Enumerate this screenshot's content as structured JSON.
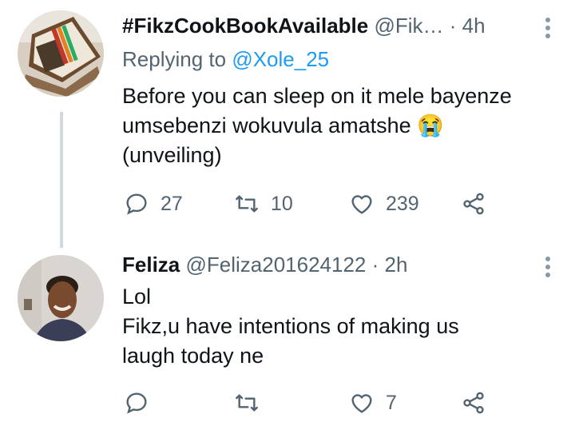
{
  "tweets": [
    {
      "display_name": "#FikzCookBookAvailable",
      "handle": "@Fik…",
      "time": "· 4h",
      "reply_prefix": "Replying to ",
      "reply_to": "@Xole_25",
      "text_lines": [
        "Before you can sleep on it mele bayenze",
        "umsebenzi wokuvula amatshe 😭",
        "(unveiling)"
      ],
      "replies": "27",
      "retweets": "10",
      "likes": "239"
    },
    {
      "display_name": "Feliza",
      "handle": "@Feliza201624122",
      "time": "· 2h",
      "text_lines": [
        "Lol",
        "Fikz,u have intentions of making us",
        "laugh today ne"
      ],
      "replies": "",
      "retweets": "",
      "likes": "7"
    }
  ],
  "icons": {
    "reply": "reply-icon",
    "retweet": "retweet-icon",
    "like": "heart-icon",
    "share": "share-icon",
    "more": "more-vertical-icon"
  },
  "colors": {
    "text": "#0f1419",
    "muted": "#536471",
    "link": "#1d9bf0",
    "thread_line": "#cfd9de"
  }
}
